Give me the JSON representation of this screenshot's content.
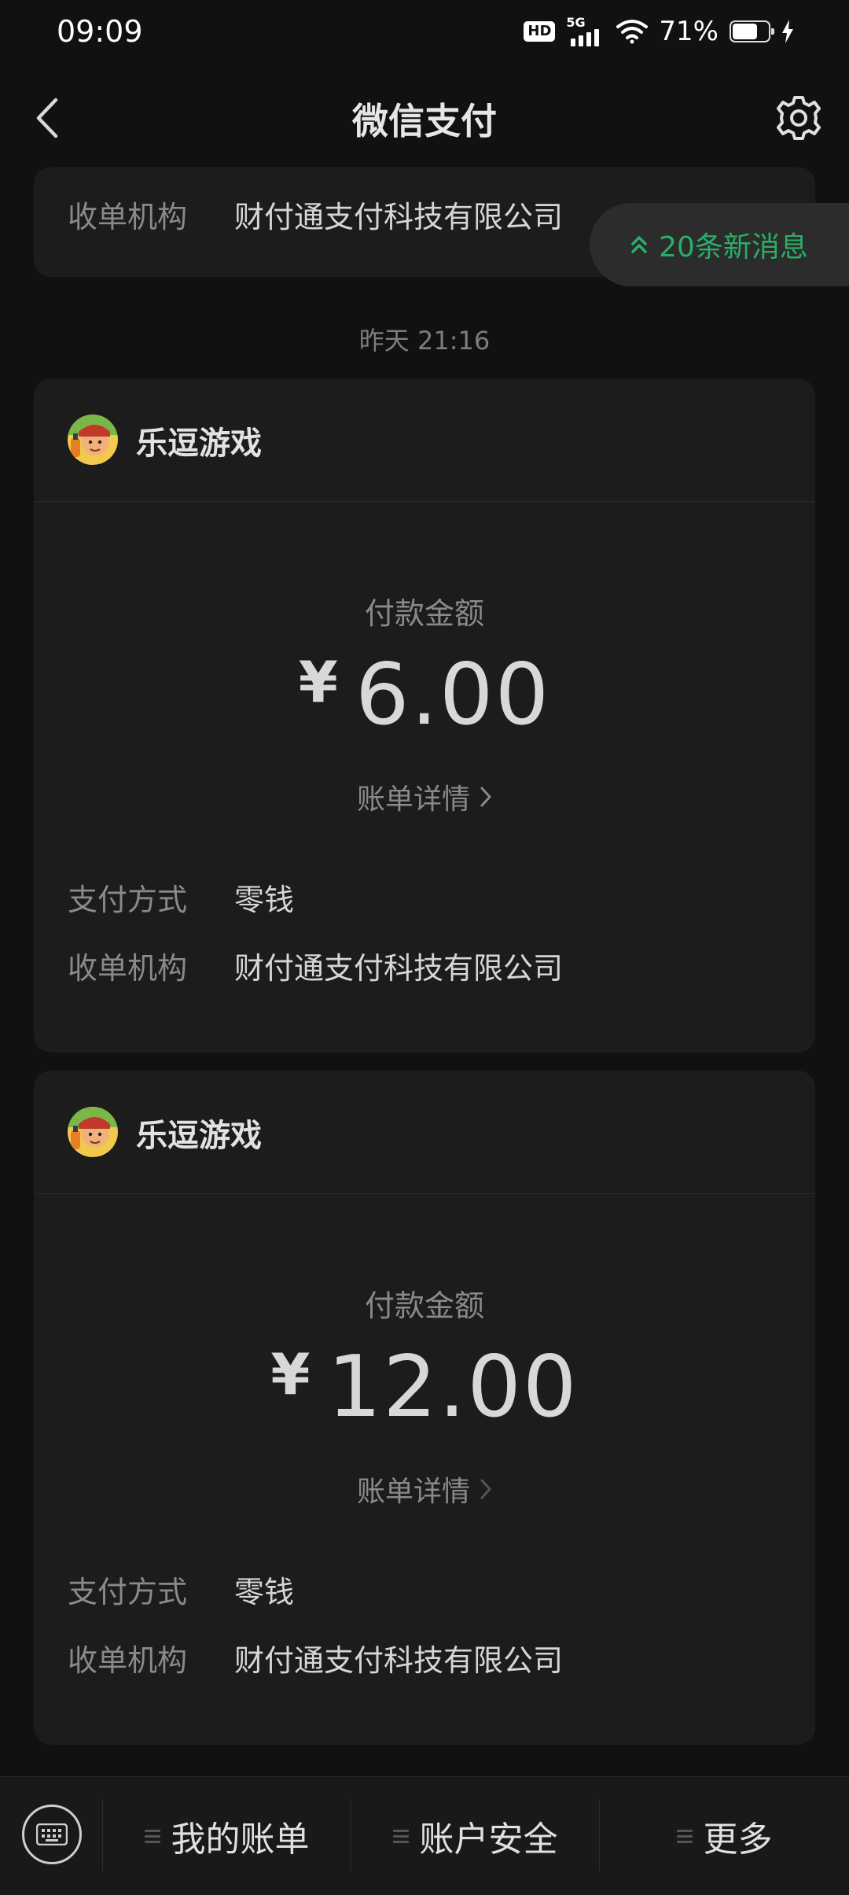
{
  "status": {
    "time": "09:09",
    "hd": "HD",
    "network": "5G",
    "battery": "71%",
    "battery_level": 0.71
  },
  "nav": {
    "title": "微信支付",
    "back_icon": "chevron-left-icon",
    "settings_icon": "gear-icon"
  },
  "new_messages": {
    "label": "20条新消息",
    "icon": "double-chevron-up-icon",
    "color": "#2aae67"
  },
  "top_partial": {
    "acquirer_label": "收单机构",
    "acquirer_value": "财付通支付科技有限公司"
  },
  "timestamp": "昨天 21:16",
  "payments": [
    {
      "merchant": "乐逗游戏",
      "amount_label": "付款金额",
      "currency": "¥",
      "amount": "6.00",
      "detail_link": "账单详情",
      "method_label": "支付方式",
      "method_value": "零钱",
      "acquirer_label": "收单机构",
      "acquirer_value": "财付通支付科技有限公司"
    },
    {
      "merchant": "乐逗游戏",
      "amount_label": "付款金额",
      "currency": "¥",
      "amount": "12.00",
      "detail_link": "账单详情",
      "method_label": "支付方式",
      "method_value": "零钱",
      "acquirer_label": "收单机构",
      "acquirer_value": "财付通支付科技有限公司"
    }
  ],
  "bottom_menu": {
    "keyboard_icon": "keyboard-icon",
    "items": [
      "我的账单",
      "账户安全",
      "更多"
    ]
  }
}
